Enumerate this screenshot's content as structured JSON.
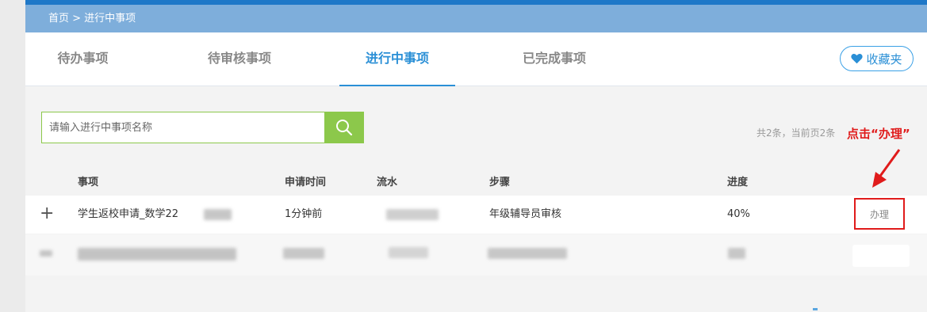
{
  "breadcrumb": "首页 > 进行中事项",
  "tabs": [
    {
      "label": "待办事项"
    },
    {
      "label": "待审核事项"
    },
    {
      "label": "进行中事项"
    },
    {
      "label": "已完成事项"
    }
  ],
  "favorites": {
    "label": "收藏夹",
    "icon": "heart-icon"
  },
  "search": {
    "placeholder": "请输入进行中事项名称",
    "icon": "search-icon"
  },
  "pager": {
    "info": "共2条，当前页2条"
  },
  "annotation": {
    "text": "点击“办理”",
    "color": "#e01b1b"
  },
  "table": {
    "headers": [
      "事项",
      "申请时间",
      "流水",
      "步骤",
      "进度"
    ],
    "rows": [
      {
        "item": "学生返校申请_数学22",
        "time": "1分钟前",
        "step": "年级辅导员审核",
        "progress": "40%",
        "action": "办理"
      }
    ]
  },
  "colors": {
    "accent": "#2a8fd6",
    "search_green": "#8cc84b",
    "breadcrumb_bg": "#7eaedb",
    "topbar": "#1e78c8"
  }
}
